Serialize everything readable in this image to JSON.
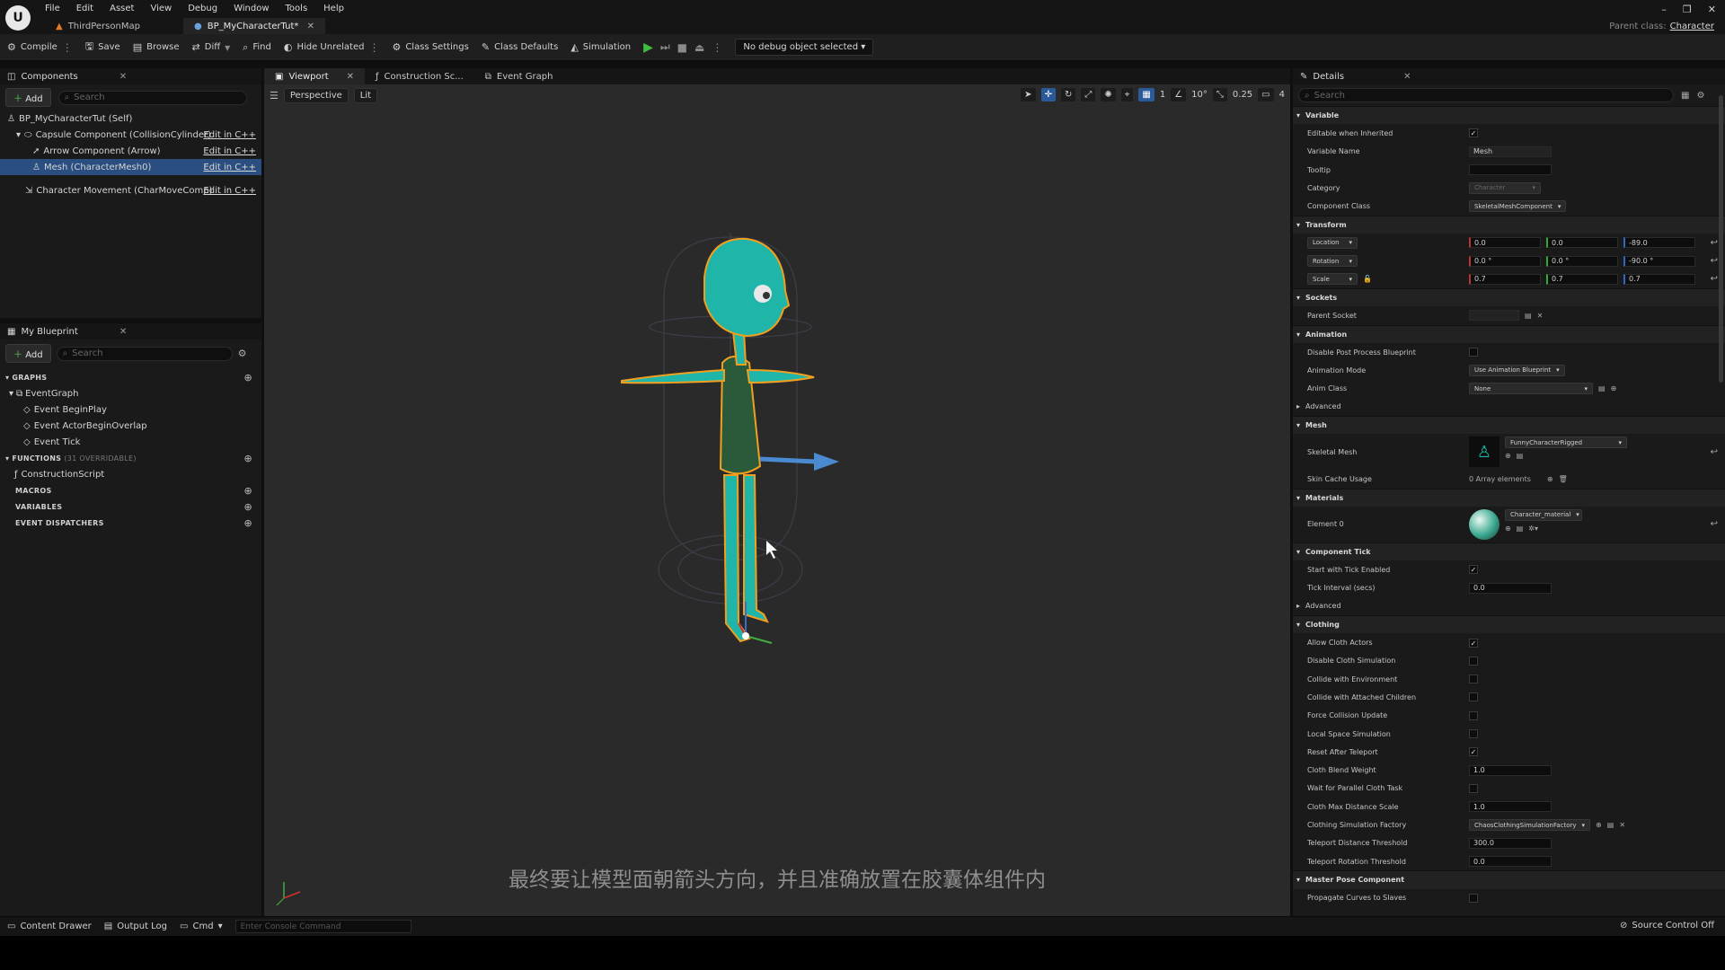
{
  "menu": [
    "File",
    "Edit",
    "Asset",
    "View",
    "Debug",
    "Window",
    "Tools",
    "Help"
  ],
  "doc_tabs": [
    {
      "label": "ThirdPersonMap"
    },
    {
      "label": "BP_MyCharacterTut*"
    }
  ],
  "parent_class": {
    "label": "Parent class:",
    "value": "Character"
  },
  "toolbar": {
    "compile": "Compile",
    "save": "Save",
    "browse": "Browse",
    "diff": "Diff",
    "find": "Find",
    "hide_unrelated": "Hide Unrelated",
    "class_settings": "Class Settings",
    "class_defaults": "Class Defaults",
    "simulation": "Simulation",
    "debug_object": "No debug object selected"
  },
  "components": {
    "tab": "Components",
    "add": "Add",
    "search_placeholder": "Search",
    "items": [
      {
        "label": "BP_MyCharacterTut (Self)",
        "edit": ""
      },
      {
        "label": "Capsule Component (CollisionCylinder)",
        "edit": "Edit in C++"
      },
      {
        "label": "Arrow Component (Arrow)",
        "edit": "Edit in C++"
      },
      {
        "label": "Mesh (CharacterMesh0)",
        "edit": "Edit in C++"
      },
      {
        "label": "Character Movement (CharMoveComp)",
        "edit": "Edit in C++"
      }
    ]
  },
  "my_blueprint": {
    "tab": "My Blueprint",
    "add": "Add",
    "search_placeholder": "Search",
    "graphs_label": "GRAPHS",
    "event_graph": "EventGraph",
    "events": [
      "Event BeginPlay",
      "Event ActorBeginOverlap",
      "Event Tick"
    ],
    "functions_label": "FUNCTIONS",
    "functions_count": "(31 OVERRIDABLE)",
    "construction_script": "ConstructionScript",
    "macros_label": "MACROS",
    "variables_label": "VARIABLES",
    "dispatchers_label": "EVENT DISPATCHERS"
  },
  "viewport": {
    "tabs": [
      "Viewport",
      "Construction Sc...",
      "Event Graph"
    ],
    "perspective": "Perspective",
    "lit": "Lit",
    "grid_value": "1",
    "angle_value": "10°",
    "scale_value": "0.25",
    "camera_speed": "4",
    "subtitle": "最终要让模型面朝箭头方向，并且准确放置在胶囊体组件内"
  },
  "details": {
    "tab": "Details",
    "search_placeholder": "Search",
    "variable": {
      "section": "Variable",
      "editable_label": "Editable when Inherited",
      "name_label": "Variable Name",
      "name_value": "Mesh",
      "tooltip_label": "Tooltip",
      "category_label": "Category",
      "category_value": "Character",
      "class_label": "Component Class",
      "class_value": "SkeletalMeshComponent"
    },
    "transform": {
      "section": "Transform",
      "location": {
        "label": "Location",
        "x": "0.0",
        "y": "0.0",
        "z": "-89.0"
      },
      "rotation": {
        "label": "Rotation",
        "x": "0.0 °",
        "y": "0.0 °",
        "z": "-90.0 °"
      },
      "scale": {
        "label": "Scale",
        "x": "0.7",
        "y": "0.7",
        "z": "0.7"
      }
    },
    "sockets": {
      "section": "Sockets",
      "parent_label": "Parent Socket"
    },
    "animation": {
      "section": "Animation",
      "disable_pp_label": "Disable Post Process Blueprint",
      "mode_label": "Animation Mode",
      "mode_value": "Use Animation Blueprint",
      "anim_class_label": "Anim Class",
      "anim_class_value": "None",
      "advanced": "Advanced"
    },
    "mesh": {
      "section": "Mesh",
      "skeletal_label": "Skeletal Mesh",
      "skeletal_value": "FunnyCharacterRigged",
      "skin_cache_label": "Skin Cache Usage",
      "skin_cache_value": "0 Array elements"
    },
    "materials": {
      "section": "Materials",
      "element_label": "Element 0",
      "element_value": "Character_material"
    },
    "component_tick": {
      "section": "Component Tick",
      "start_label": "Start with Tick Enabled",
      "interval_label": "Tick Interval (secs)",
      "interval_value": "0.0",
      "advanced": "Advanced"
    },
    "clothing": {
      "section": "Clothing",
      "rows": [
        {
          "label": "Allow Cloth Actors",
          "checked": true
        },
        {
          "label": "Disable Cloth Simulation",
          "checked": false
        },
        {
          "label": "Collide with Environment",
          "checked": false
        },
        {
          "label": "Collide with Attached Children",
          "checked": false
        },
        {
          "label": "Force Collision Update",
          "checked": false
        },
        {
          "label": "Local Space Simulation",
          "checked": false
        },
        {
          "label": "Reset After Teleport",
          "checked": true
        }
      ],
      "blend_label": "Cloth Blend Weight",
      "blend_value": "1.0",
      "wait_label": "Wait for Parallel Cloth Task",
      "max_dist_label": "Cloth Max Distance Scale",
      "max_dist_value": "1.0",
      "factory_label": "Clothing Simulation Factory",
      "factory_value": "ChaosClothingSimulationFactory",
      "tp_dist_label": "Teleport Distance Threshold",
      "tp_dist_value": "300.0",
      "tp_rot_label": "Teleport Rotation Threshold",
      "tp_rot_value": "0.0"
    },
    "master_pose": {
      "section": "Master Pose Component",
      "propagate_label": "Propagate Curves to Slaves"
    }
  },
  "bottom": {
    "content_drawer": "Content Drawer",
    "output_log": "Output Log",
    "cmd": "Cmd",
    "console_placeholder": "Enter Console Command",
    "source_control": "Source Control Off"
  },
  "colors": {
    "character": "#1fb5a8",
    "character_dark": "#2b5a3a",
    "outline": "#f0a020",
    "selection": "#2a4e80",
    "play": "#3fbf3f"
  }
}
